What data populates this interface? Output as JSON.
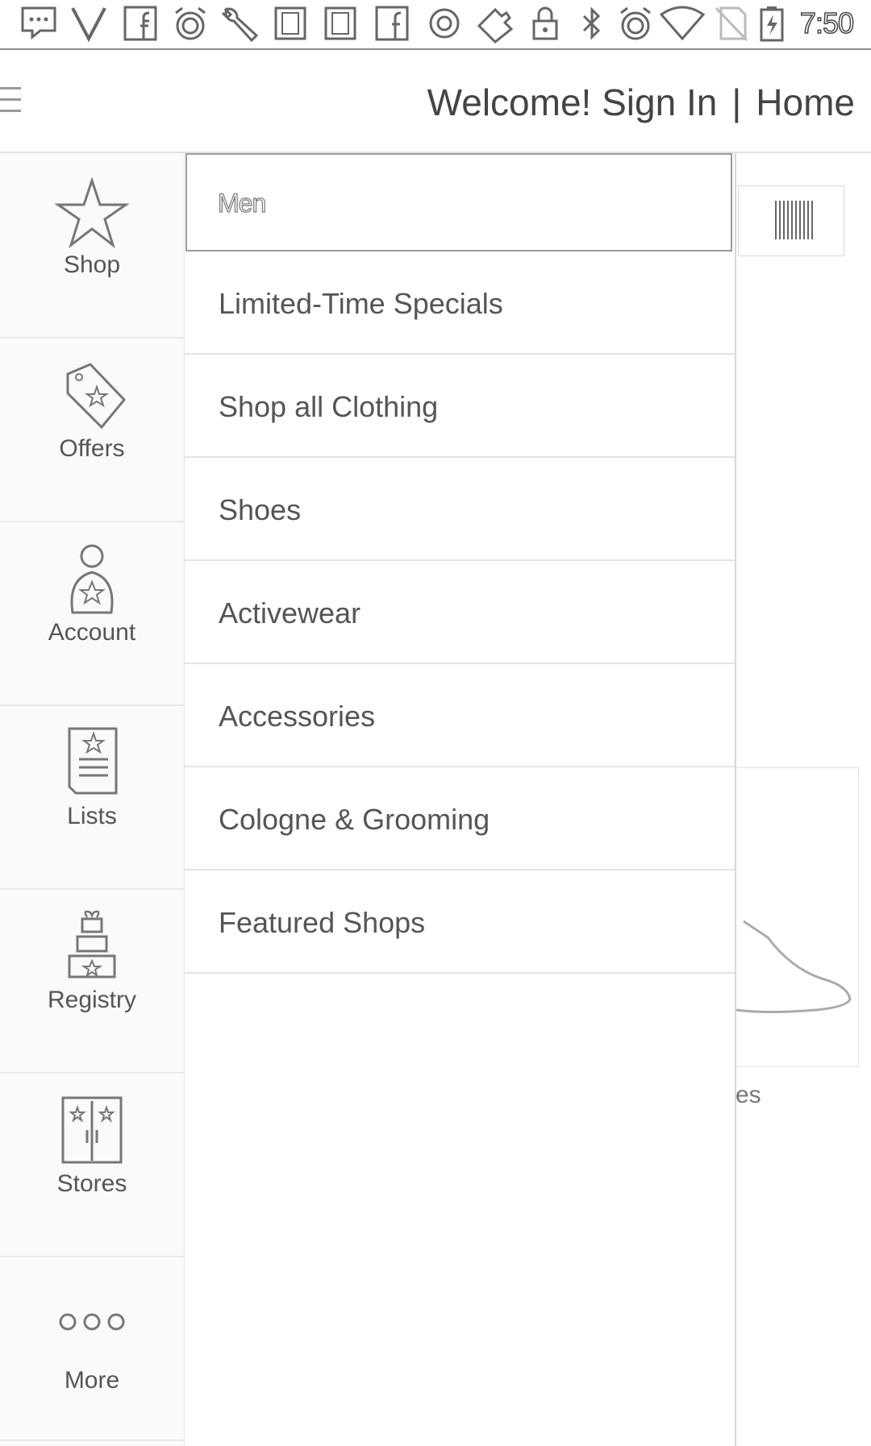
{
  "status_bar": {
    "time": "7:50",
    "icons": [
      "more-chat-icon",
      "v-app-icon",
      "facebook-icon",
      "alarm-icon",
      "wrench-icon",
      "notification-icon",
      "notification-icon",
      "facebook-icon",
      "circle-app-icon",
      "puzzle-icon",
      "lock-icon",
      "bluetooth-icon",
      "alarm-icon",
      "wifi-icon",
      "no-sim-icon",
      "battery-charging-icon"
    ]
  },
  "header": {
    "welcome": "Welcome! Sign In",
    "separator": "|",
    "home": "Home"
  },
  "rail": {
    "items": [
      {
        "label": "Shop",
        "icon": "star-icon"
      },
      {
        "label": "Offers",
        "icon": "tag-icon"
      },
      {
        "label": "Account",
        "icon": "account-icon"
      },
      {
        "label": "Lists",
        "icon": "list-icon"
      },
      {
        "label": "Registry",
        "icon": "gift-icon"
      },
      {
        "label": "Stores",
        "icon": "store-icon"
      },
      {
        "label": "More",
        "icon": "more-dots-icon"
      }
    ]
  },
  "drawer": {
    "selected_category": "Men",
    "items": [
      {
        "label": "Limited-Time Specials"
      },
      {
        "label": "Shop all Clothing"
      },
      {
        "label": "Shoes"
      },
      {
        "label": "Activewear"
      },
      {
        "label": "Accessories"
      },
      {
        "label": "Cologne & Grooming"
      },
      {
        "label": "Featured Shops"
      }
    ]
  },
  "background": {
    "partial_text": "es",
    "barcode_icon": "barcode-icon"
  }
}
